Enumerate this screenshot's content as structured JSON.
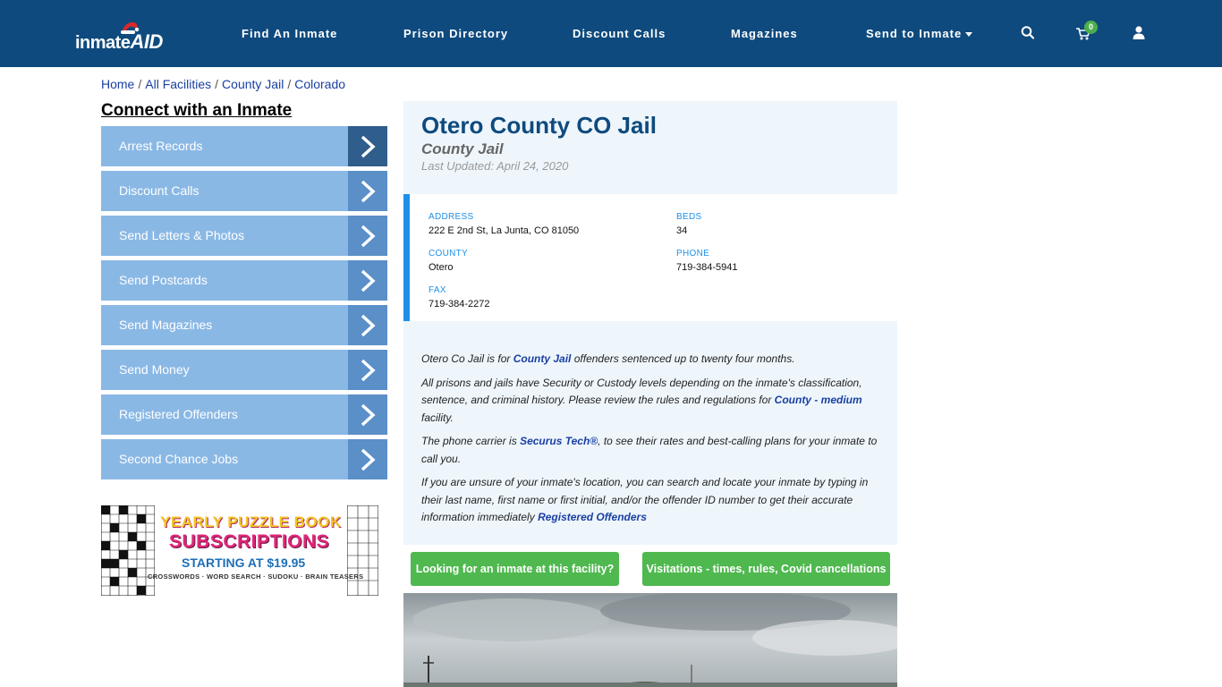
{
  "header": {
    "logo_text_a": "inmate",
    "logo_text_b": "AID",
    "nav": [
      "Find An Inmate",
      "Prison Directory",
      "Discount Calls",
      "Magazines",
      "Send to Inmate"
    ],
    "cart_count": "0",
    "bg_color": "#0e4a7e"
  },
  "breadcrumb": [
    "Home",
    "All Facilities",
    "County Jail",
    "Colorado"
  ],
  "sidebar": {
    "title": "Connect with an Inmate",
    "items": [
      "Arrest Records",
      "Discount Calls",
      "Send Letters & Photos",
      "Send Postcards",
      "Send Magazines",
      "Send Money",
      "Registered Offenders",
      "Second Chance Jobs"
    ]
  },
  "ad": {
    "line1": "YEARLY PUZZLE BOOK",
    "line2": "SUBSCRIPTIONS",
    "line3": "STARTING AT $19.95",
    "line4": "CROSSWORDS · WORD SEARCH · SUDOKU · BRAIN TEASERS"
  },
  "facility": {
    "name": "Otero County CO Jail",
    "type": "County Jail",
    "updated": "Last Updated: April 24, 2020",
    "fields": {
      "address_label": "ADDRESS",
      "address": "222 E 2nd St, La Junta, CO 81050",
      "beds_label": "BEDS",
      "beds": "34",
      "county_label": "COUNTY",
      "county": "Otero",
      "phone_label": "PHONE",
      "phone": "719-384-5941",
      "fax_label": "FAX",
      "fax": "719-384-2272"
    }
  },
  "description": {
    "p1_a": "Otero Co Jail is for ",
    "p1_link": "County Jail",
    "p1_b": " offenders sentenced up to twenty four months.",
    "p2_a": "All prisons and jails have Security or Custody levels depending on the inmate's classification, sentence, and criminal history. Please review the rules and regulations for ",
    "p2_link": "County - medium",
    "p2_b": " facility.",
    "p3_a": "The phone carrier is ",
    "p3_link": "Securus Tech®",
    "p3_b": ", to see their rates and best-calling plans for your inmate to call you.",
    "p4_a": "If you are unsure of your inmate's location, you can search and locate your inmate by typing in their last name, first name or first initial, and/or the offender ID number to get their accurate information immediately ",
    "p4_link": "Registered Offenders"
  },
  "buttons": {
    "find_inmate": "Looking for an inmate at this facility?",
    "visitations": "Visitations - times, rules, Covid cancellations"
  }
}
